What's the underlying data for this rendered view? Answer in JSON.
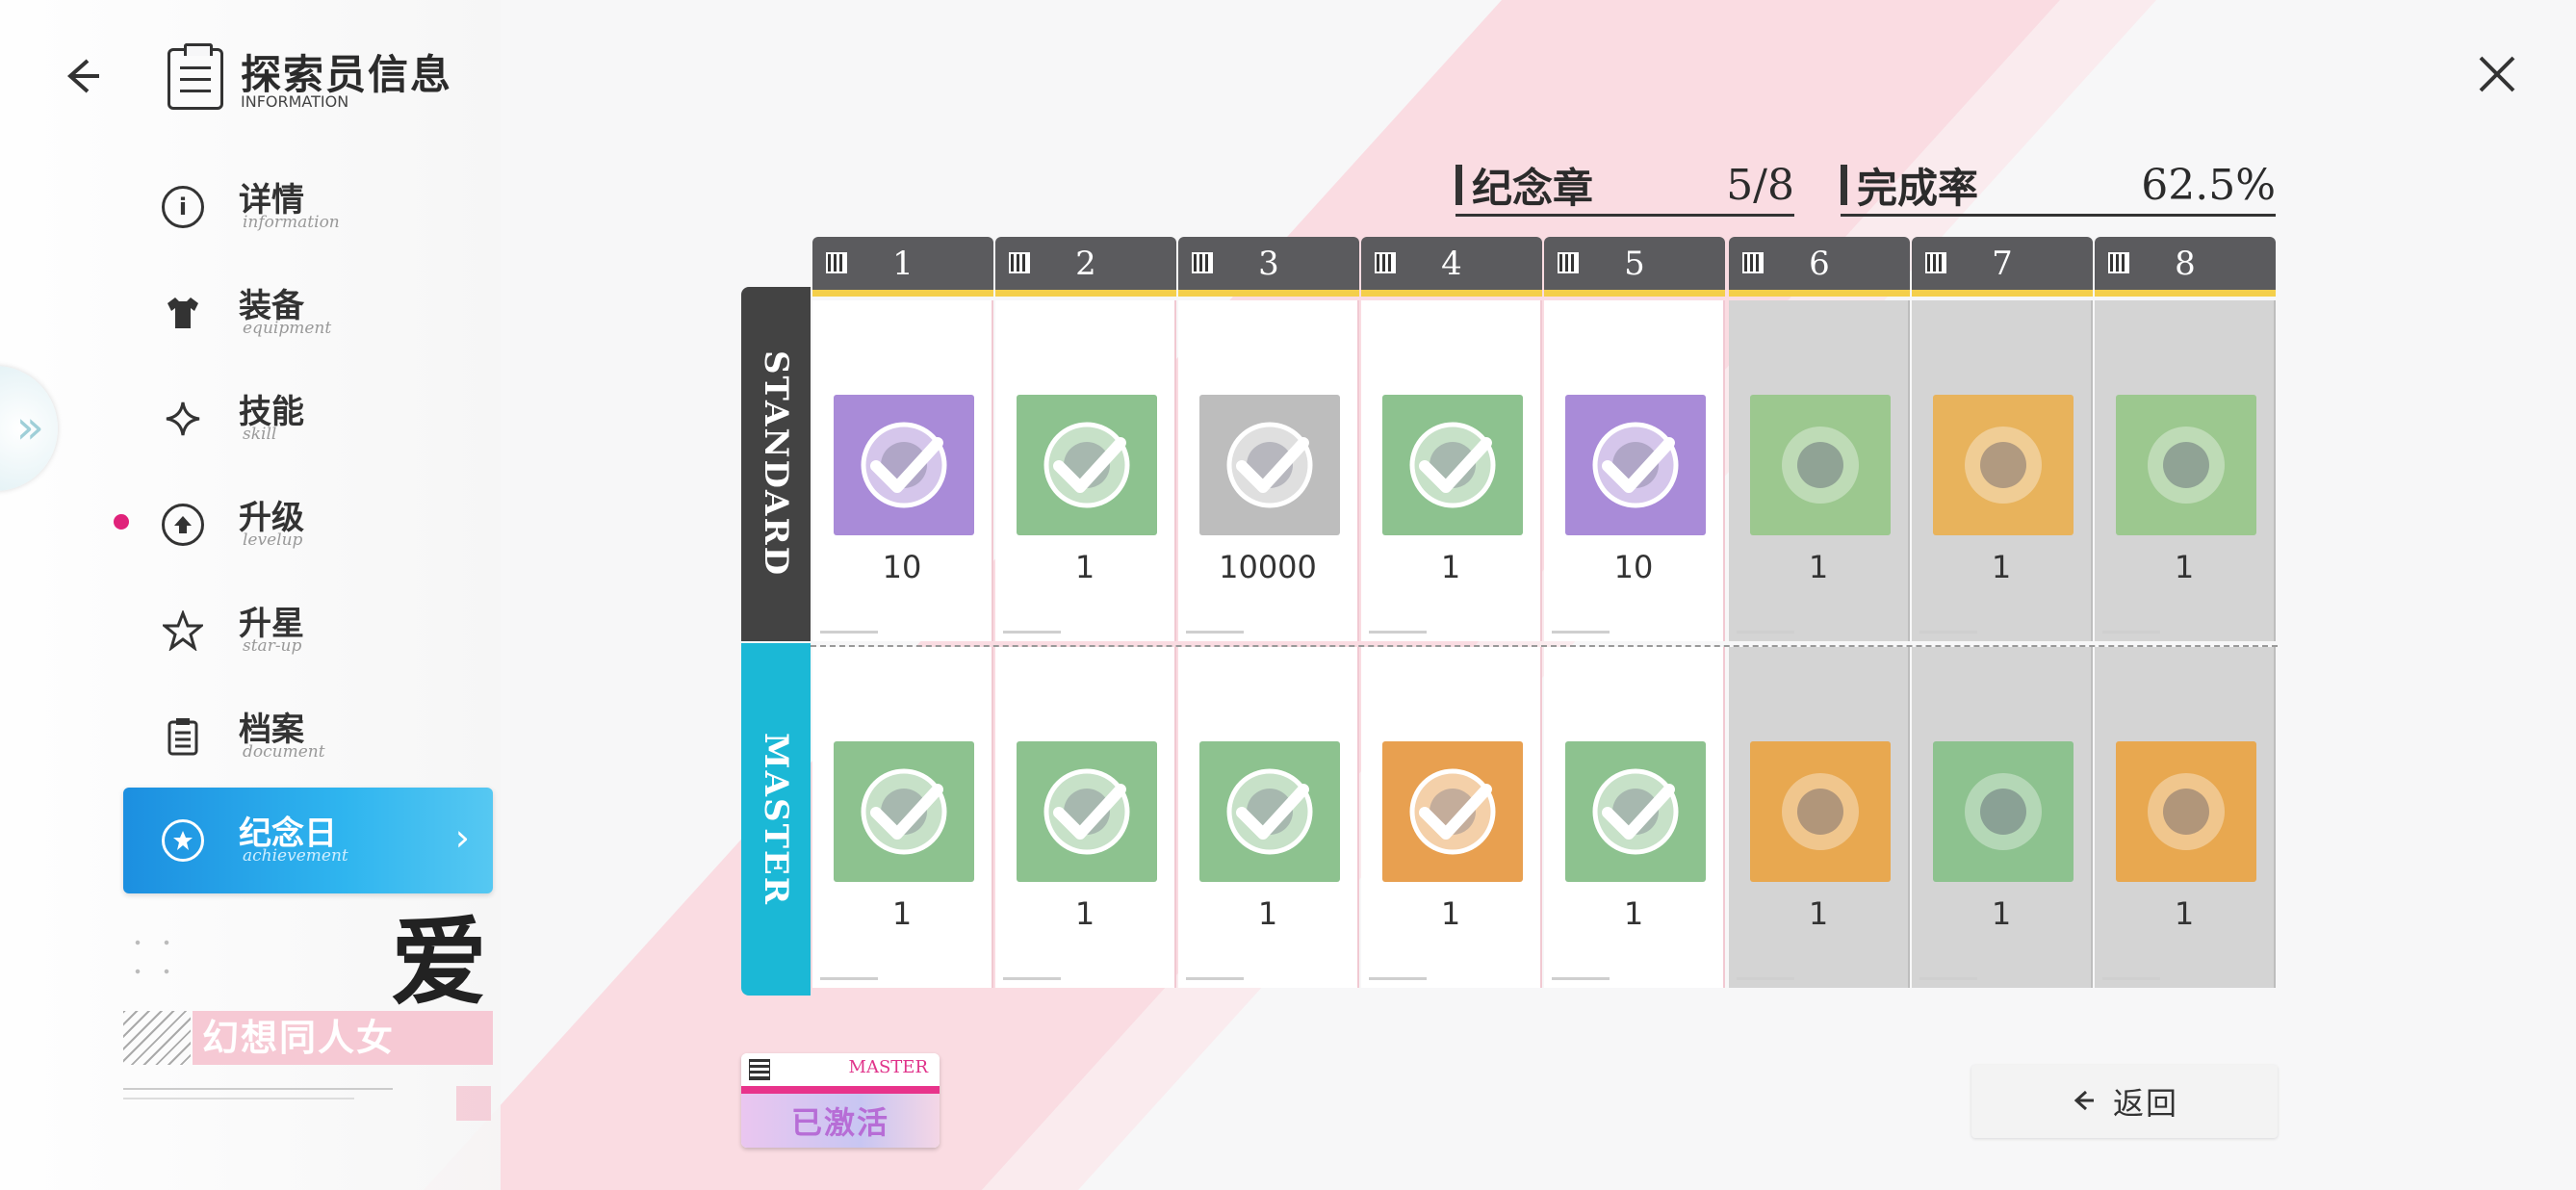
{
  "header": {
    "title": "探索员信息",
    "subtitle": "INFORMATION",
    "back_icon": "back-arrow-icon",
    "close_icon": "close-icon"
  },
  "menu": {
    "items": [
      {
        "label": "详情",
        "sub": "information",
        "icon": "info-icon",
        "glyph": "i"
      },
      {
        "label": "装备",
        "sub": "equipment",
        "icon": "shirt-icon",
        "glyph": "👕"
      },
      {
        "label": "技能",
        "sub": "skill",
        "icon": "sparkle-icon",
        "glyph": "✧"
      },
      {
        "label": "升级",
        "sub": "levelup",
        "icon": "upgrade-icon",
        "glyph": "⬆"
      },
      {
        "label": "升星",
        "sub": "star-up",
        "icon": "star-icon",
        "glyph": "☆"
      },
      {
        "label": "档案",
        "sub": "document",
        "icon": "document-icon",
        "glyph": "▤"
      },
      {
        "label": "纪念日",
        "sub": "achievement",
        "icon": "badge-icon",
        "glyph": "★"
      }
    ],
    "active_index": 6,
    "notify_index": 3
  },
  "decor": {
    "big_char": "爱",
    "slogan": "幻想同人女"
  },
  "stats": {
    "badges_label": "纪念章",
    "badges_value": "5/8",
    "completion_label": "完成率",
    "completion_value": "62.5%"
  },
  "grid": {
    "columns": [
      "1",
      "2",
      "3",
      "4",
      "5",
      "6",
      "7",
      "8"
    ],
    "rows": [
      {
        "label": "STANDARD",
        "color": "#434343",
        "cells": [
          {
            "qty": "10",
            "done": true,
            "tile_bg": "#a98bd8",
            "item": "purple-emblem"
          },
          {
            "qty": "1",
            "done": true,
            "tile_bg": "#8dc28f",
            "item": "sticker-character"
          },
          {
            "qty": "10000",
            "done": true,
            "tile_bg": "#bdbdbd",
            "item": "gold-coin"
          },
          {
            "qty": "1",
            "done": true,
            "tile_bg": "#8dc28f",
            "item": "sticker-character"
          },
          {
            "qty": "10",
            "done": true,
            "tile_bg": "#a98bd8",
            "item": "purple-emblem"
          },
          {
            "qty": "1",
            "done": false,
            "tile_bg": "#9cc88f",
            "item": "chat-sticker"
          },
          {
            "qty": "1",
            "done": false,
            "tile_bg": "#e8b35c",
            "item": "puzzle-sticker"
          },
          {
            "qty": "1",
            "done": false,
            "tile_bg": "#9cc88f",
            "item": "chat-sticker"
          }
        ]
      },
      {
        "label": "MASTER",
        "color": "#1bb8d6",
        "cells": [
          {
            "qty": "1",
            "done": true,
            "tile_bg": "#8dc28f",
            "item": "pink-jacket"
          },
          {
            "qty": "1",
            "done": true,
            "tile_bg": "#8dc28f",
            "item": "plant"
          },
          {
            "qty": "1",
            "done": true,
            "tile_bg": "#8dc28f",
            "item": "pink-creature"
          },
          {
            "qty": "1",
            "done": true,
            "tile_bg": "#e8a050",
            "item": "orange-box"
          },
          {
            "qty": "1",
            "done": true,
            "tile_bg": "#8dc28f",
            "item": "speaker"
          },
          {
            "qty": "1",
            "done": false,
            "tile_bg": "#e8a850",
            "item": "book"
          },
          {
            "qty": "1",
            "done": false,
            "tile_bg": "#8dc28f",
            "item": "cart"
          },
          {
            "qty": "1",
            "done": false,
            "tile_bg": "#e8a850",
            "item": "purple-gem"
          }
        ]
      }
    ]
  },
  "badge": {
    "tag": "MASTER",
    "status": "已激活"
  },
  "footer": {
    "return_label": "返回",
    "return_icon": "back-arrow-icon"
  },
  "colors": {
    "accent_blue": "#2aa7ea",
    "pink": "#f6c9d4",
    "header_yellow": "#f4cf4a",
    "header_gray": "#5b5b5e"
  }
}
